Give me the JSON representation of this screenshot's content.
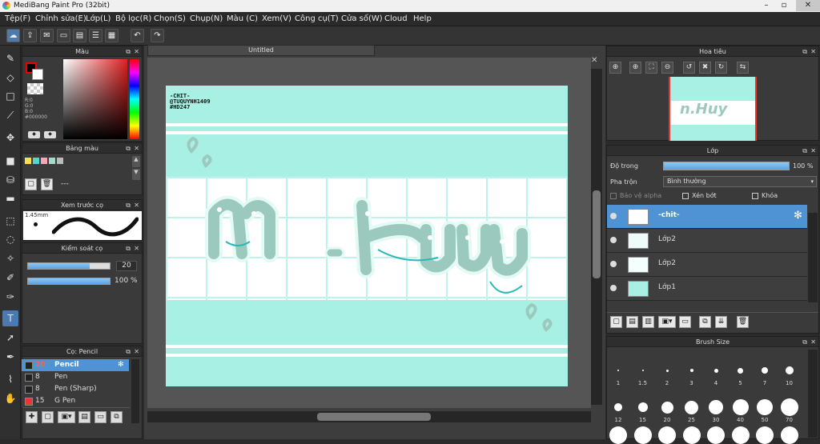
{
  "app": {
    "title": "MediBang Paint Pro (32bit)"
  },
  "menu": [
    "Tệp(F)",
    "Chỉnh sửa(E)",
    "Lớp(L)",
    "Bộ lọc(R)",
    "Chọn(S)",
    "Chụp(N)",
    "Màu (C)",
    "Xem(V)",
    "Công cụ(T)",
    "Cửa số(W)",
    "Cloud",
    "Help"
  ],
  "color_panel": {
    "title": "Màu",
    "r": "R:0",
    "g": "G:0",
    "b": "B:0",
    "hex": "#000000"
  },
  "palette_panel": {
    "title": "Bảng màu",
    "dash": "---"
  },
  "preview_panel": {
    "title": "Xem trước cọ",
    "size": "1.45mm"
  },
  "control_panel": {
    "title": "Kiểm soát cọ",
    "size_value": "20",
    "opacity_value": "100 %"
  },
  "brush_panel": {
    "title": "Cọ: Pencil",
    "items": [
      {
        "size": "20",
        "name": "Pencil"
      },
      {
        "size": "8",
        "name": "Pen"
      },
      {
        "size": "8",
        "name": "Pen (Sharp)"
      },
      {
        "size": "15",
        "name": "G Pen"
      }
    ]
  },
  "document": {
    "tab": "Untitled"
  },
  "canvas_text": {
    "line1": "-CHIT-",
    "line2": "@TUQUYNH1409",
    "line3": "#HD247"
  },
  "navigator": {
    "title": "Hoa tiêu"
  },
  "layer_panel": {
    "title": "Lớp",
    "opacity_label": "Độ trong",
    "opacity_value": "100 %",
    "blend_label": "Pha trộn",
    "blend_value": "Bình thường",
    "protect_alpha": "Bảo vệ alpha",
    "clipping": "Xén bớt",
    "lock": "Khóa",
    "layers": [
      {
        "name": "-chit-"
      },
      {
        "name": "Lớp2"
      },
      {
        "name": "Lớp2"
      },
      {
        "name": "Lớp1"
      }
    ]
  },
  "brush_size_panel": {
    "title": "Brush Size",
    "row1": [
      "1",
      "1.5",
      "2",
      "3",
      "4",
      "5",
      "7",
      "10"
    ],
    "row2": [
      "12",
      "15",
      "20",
      "25",
      "30",
      "40",
      "50",
      "70"
    ]
  },
  "colors": {
    "accent": "#4f93d4",
    "canvas_bg": "#a8f0e3",
    "letters": "#9cc9bd",
    "letter_outline": "#2bb8b8"
  }
}
